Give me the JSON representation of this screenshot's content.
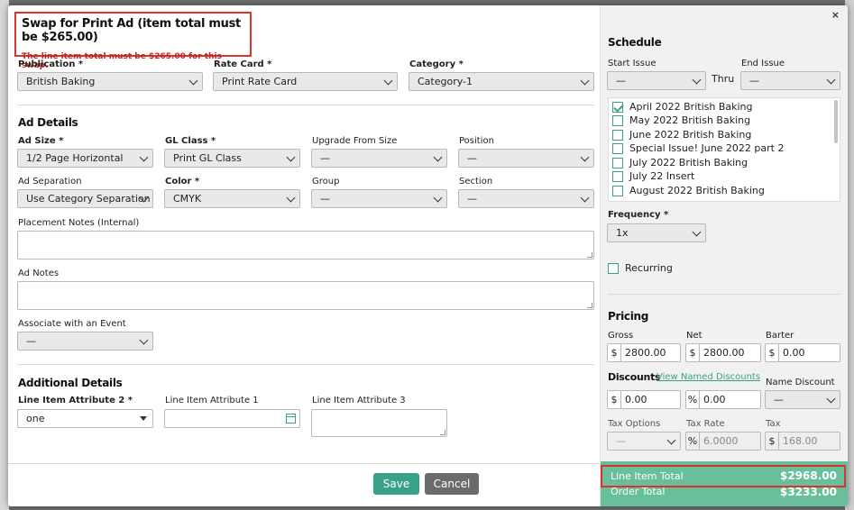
{
  "header": {
    "title": "Swap for Print Ad (item total must be $265.00)",
    "error": "The line item total must be $265.00 for this swap."
  },
  "close_label": "×",
  "publication": {
    "label": "Publication *",
    "value": "British Baking"
  },
  "rate_card": {
    "label": "Rate Card *",
    "value": "Print Rate Card"
  },
  "category": {
    "label": "Category *",
    "value": "Category-1"
  },
  "ad_details": {
    "heading": "Ad Details",
    "ad_size": {
      "label": "Ad Size *",
      "value": "1/2 Page Horizontal"
    },
    "gl_class": {
      "label": "GL Class *",
      "value": "Print GL Class"
    },
    "upgrade_from_size": {
      "label": "Upgrade From Size",
      "value": "—"
    },
    "position": {
      "label": "Position",
      "value": "—"
    },
    "ad_separation": {
      "label": "Ad Separation",
      "value": "Use Category Separation"
    },
    "color": {
      "label": "Color *",
      "value": "CMYK"
    },
    "group": {
      "label": "Group",
      "value": "—"
    },
    "section": {
      "label": "Section",
      "value": "—"
    },
    "placement_notes_label": "Placement Notes (Internal)",
    "ad_notes_label": "Ad Notes",
    "associate_event": {
      "label": "Associate with an Event",
      "value": "—"
    }
  },
  "additional_details": {
    "heading": "Additional Details",
    "attr2": {
      "label": "Line Item Attribute 2 *",
      "value": "one"
    },
    "attr1": {
      "label": "Line Item Attribute 1",
      "value": ""
    },
    "attr3": {
      "label": "Line Item Attribute 3",
      "value": ""
    }
  },
  "buttons": {
    "save": "Save",
    "cancel": "Cancel"
  },
  "schedule": {
    "heading": "Schedule",
    "start_issue": {
      "label": "Start Issue",
      "value": "—"
    },
    "thru": "Thru",
    "end_issue": {
      "label": "End Issue",
      "value": "—"
    },
    "issues": [
      {
        "label": "April 2022 British Baking",
        "checked": true
      },
      {
        "label": "May 2022 British Baking",
        "checked": false
      },
      {
        "label": "June 2022 British Baking",
        "checked": false
      },
      {
        "label": "Special Issue! June 2022 part 2",
        "checked": false
      },
      {
        "label": "July 2022 British Baking",
        "checked": false
      },
      {
        "label": "July 22 Insert",
        "checked": false
      },
      {
        "label": "August 2022 British Baking",
        "checked": false
      }
    ],
    "frequency": {
      "label": "Frequency *",
      "value": "1x"
    },
    "recurring_label": "Recurring"
  },
  "pricing": {
    "heading": "Pricing",
    "gross": {
      "label": "Gross",
      "prefix": "$",
      "value": "2800.00"
    },
    "net": {
      "label": "Net",
      "prefix": "$",
      "value": "2800.00"
    },
    "barter": {
      "label": "Barter",
      "prefix": "$",
      "value": "0.00"
    },
    "discounts_label": "Discounts",
    "view_named_discounts": "View Named Discounts",
    "discount_amount": {
      "prefix": "$",
      "value": "0.00"
    },
    "discount_percent": {
      "prefix": "%",
      "value": "0.00"
    },
    "name_discount": {
      "label": "Name Discount",
      "value": "—"
    },
    "tax_options": {
      "label": "Tax Options",
      "value": "—"
    },
    "tax_rate": {
      "label": "Tax Rate",
      "prefix": "%",
      "value": "6.0000"
    },
    "tax": {
      "label": "Tax",
      "prefix": "$",
      "value": "168.00"
    }
  },
  "totals": {
    "line_item_label": "Line Item Total",
    "line_item_value": "$2968.00",
    "order_label": "Order Total",
    "order_value": "$3233.00"
  },
  "colors": {
    "accent": "#3aa189",
    "error": "#d9342b",
    "totals_bg": "#68bf9a"
  }
}
